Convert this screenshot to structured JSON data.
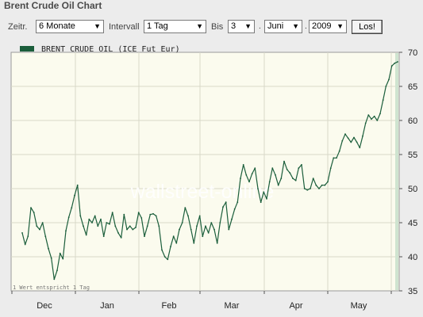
{
  "header": {
    "title": "Brent Crude Oil Chart"
  },
  "toolbar": {
    "zeitraum_label": "Zeitr.",
    "zeitraum_value": "6 Monate",
    "intervall_label": "Intervall",
    "intervall_value": "1 Tag",
    "bis_label": "Bis",
    "day_value": "3",
    "month_value": "Juni",
    "year_value": "2009",
    "submit_label": "Los!",
    "separator": "."
  },
  "colors": {
    "series": "#1b5e3b",
    "plot_bg": "#fbfbee",
    "grid": "#d8d8c8"
  },
  "watermark": "wallstreet-online",
  "footnote": "1 Wert entspricht 1 Tag",
  "chart_data": {
    "type": "line",
    "legend": "BRENT CRUDE OIL (ICE Fut Eur)",
    "legend_position": "top-left",
    "grid": true,
    "ylim": [
      35,
      70
    ],
    "y_axis_side": "right",
    "yticks": [
      35,
      40,
      45,
      50,
      55,
      60,
      65,
      70
    ],
    "xticks": [
      "Dec",
      "Jan",
      "Feb",
      "Mar",
      "Apr",
      "May"
    ],
    "series": [
      {
        "values": [
          43.5,
          41.8,
          43,
          47.2,
          46.5,
          44.5,
          44,
          45,
          43,
          41.2,
          39.8,
          36.7,
          38,
          40.5,
          39.7,
          43.8,
          45.8,
          47.2,
          49,
          50.5,
          46,
          44.5,
          43.2,
          45.5,
          45,
          46,
          44.5,
          45.5,
          43,
          45,
          44.8,
          46.5,
          44.5,
          43.5,
          42.8,
          46.2,
          44,
          44.5,
          44,
          44.3,
          46.5,
          45.7,
          43,
          44.5,
          46.2,
          46.3,
          46,
          44.5,
          41,
          40,
          39.6,
          41.5,
          43,
          42,
          44,
          45,
          47.2,
          46,
          44,
          42,
          44.5,
          46,
          43,
          44.5,
          43.5,
          45,
          44,
          42,
          45,
          47.3,
          48,
          44,
          45.5,
          47,
          48,
          51.5,
          53.5,
          52,
          51,
          52.2,
          53,
          50,
          48,
          49.5,
          48.5,
          51,
          53,
          52,
          50.5,
          51.5,
          54,
          52.8,
          52.3,
          51.5,
          51.2,
          53,
          53.5,
          50,
          49.8,
          50,
          51.5,
          50.5,
          50,
          50.5,
          50.5,
          51,
          53,
          54.5,
          54.5,
          55.5,
          57,
          58,
          57.4,
          56.8,
          57.5,
          56.8,
          56,
          57.7,
          59.6,
          60.8,
          60.2,
          60.6,
          60,
          61,
          63,
          65,
          66,
          68,
          68.4,
          68.6
        ]
      }
    ]
  }
}
